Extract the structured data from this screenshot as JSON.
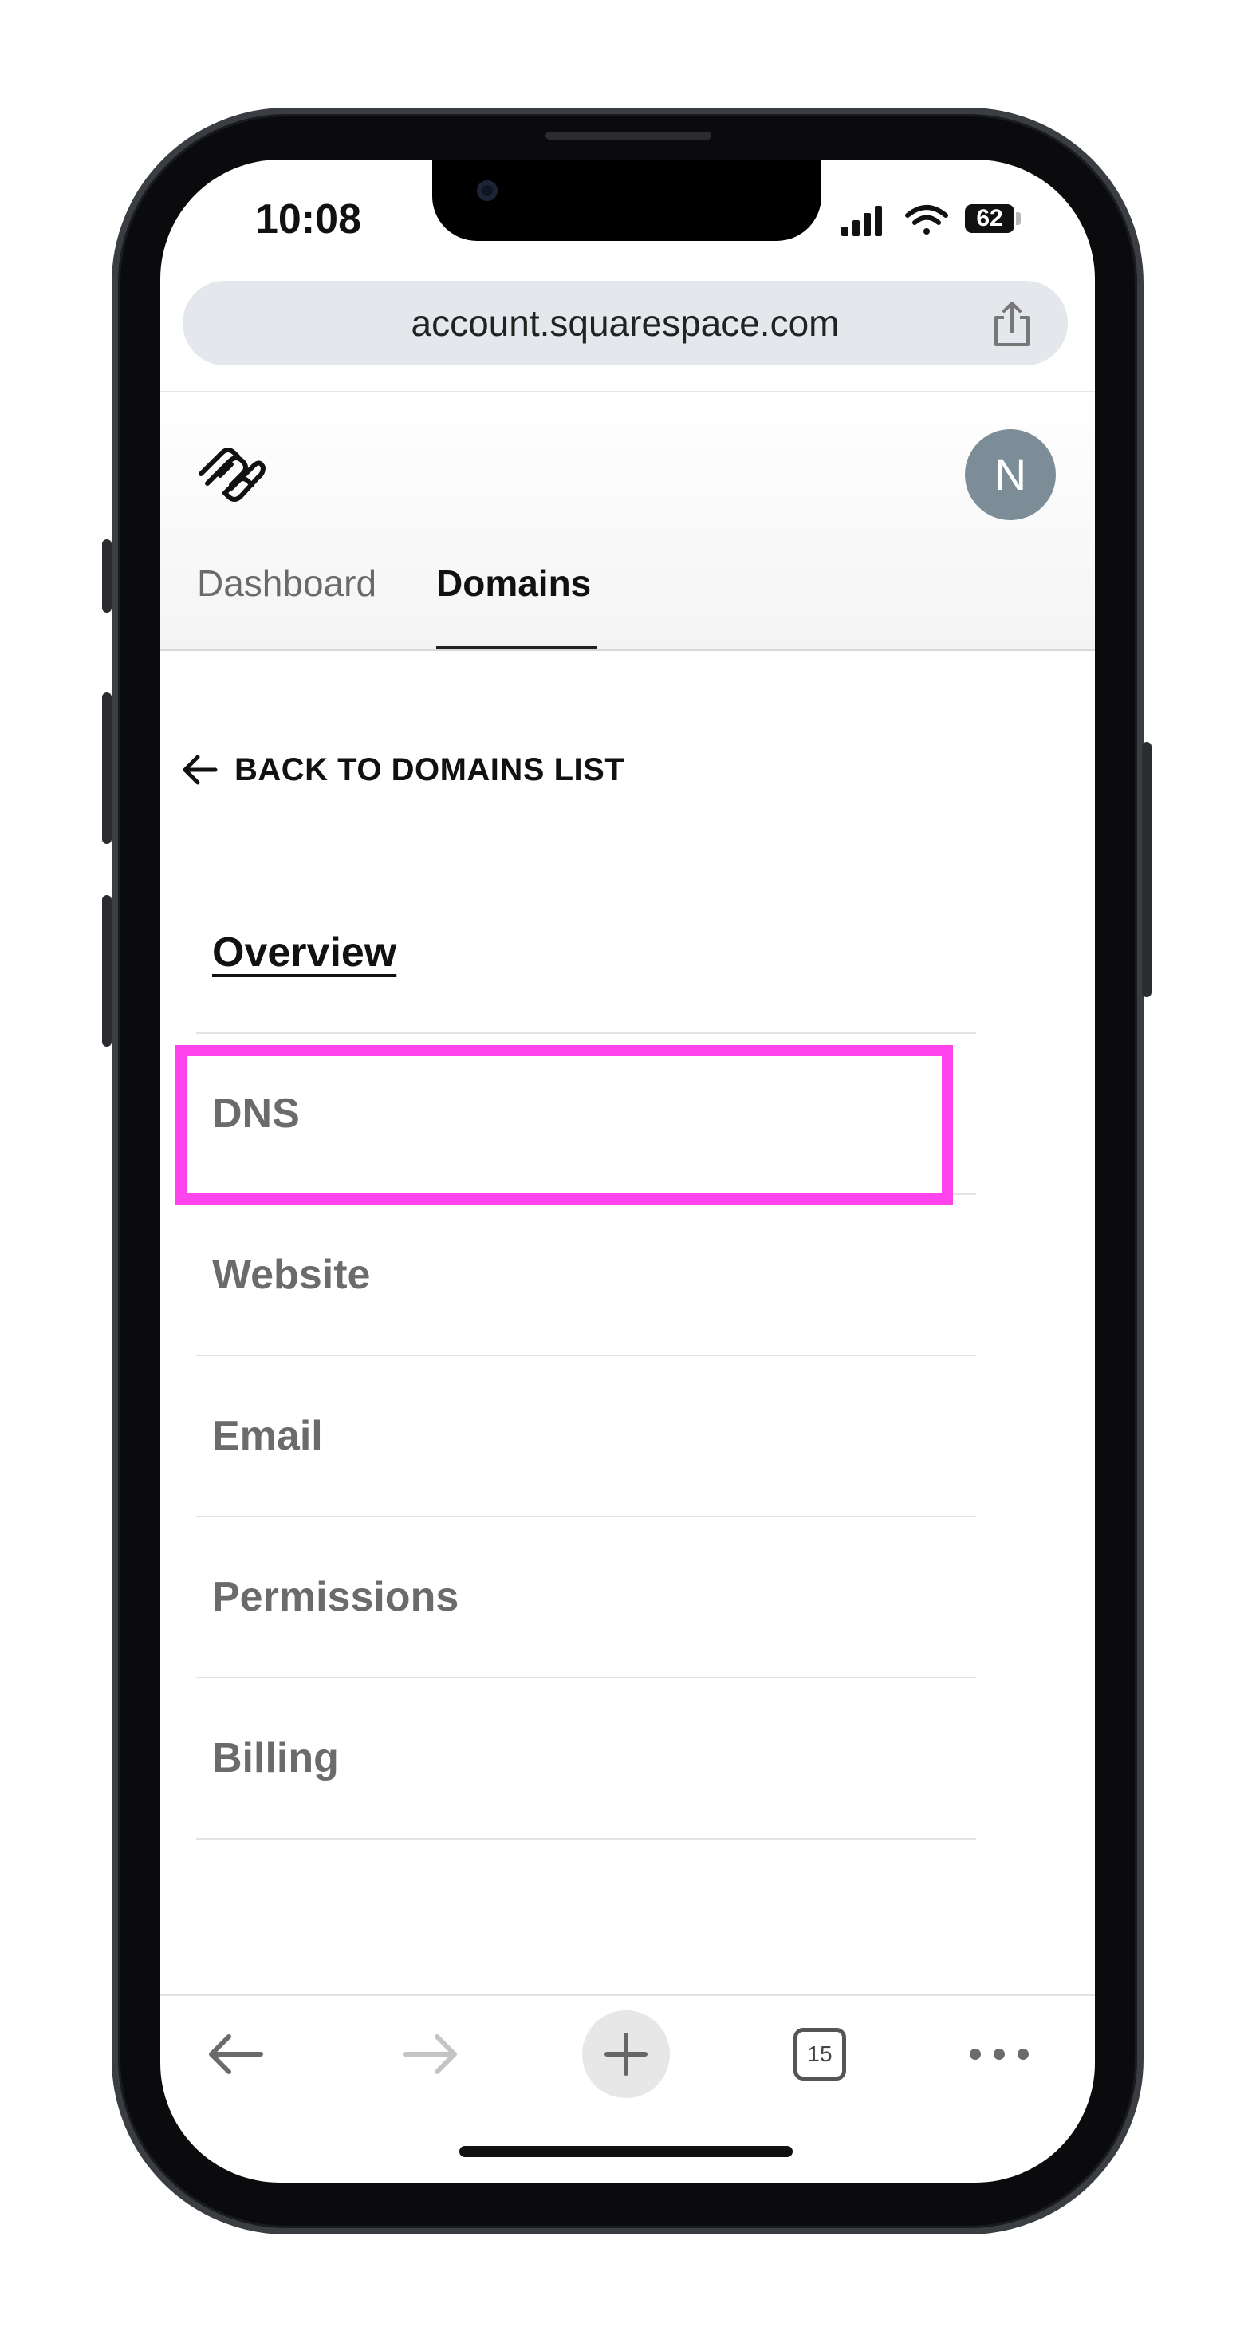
{
  "status_bar": {
    "time": "10:08",
    "battery": "62"
  },
  "browser": {
    "url": "account.squarespace.com",
    "open_tabs": "15"
  },
  "header": {
    "avatar_initial": "N"
  },
  "tabs": [
    {
      "label": "Dashboard",
      "active": false
    },
    {
      "label": "Domains",
      "active": true
    }
  ],
  "back_link": {
    "label": "BACK TO DOMAINS LIST"
  },
  "menu": {
    "items": [
      {
        "label": "Overview",
        "active": true
      },
      {
        "label": "DNS",
        "highlighted": true
      },
      {
        "label": "Website"
      },
      {
        "label": "Email"
      },
      {
        "label": "Permissions"
      },
      {
        "label": "Billing"
      }
    ]
  },
  "colors": {
    "highlight": "#ff44ee",
    "avatar": "#7d8d98",
    "url_bar": "#e4e7eb"
  },
  "icons": {
    "toolbar": [
      "back-arrow-icon",
      "forward-arrow-icon",
      "plus-icon",
      "tabs-icon",
      "more-icon"
    ],
    "status": [
      "signal-icon",
      "wifi-icon",
      "battery-icon"
    ]
  }
}
